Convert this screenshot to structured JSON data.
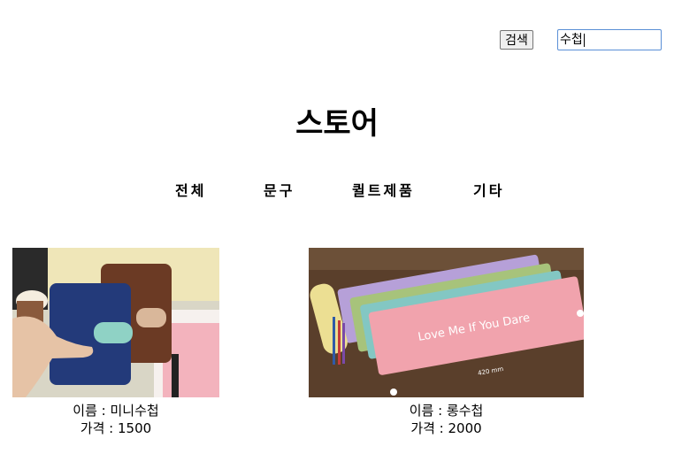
{
  "header": {
    "search_button_label": "검색",
    "search_value": "수첩"
  },
  "store_title": "스토어",
  "nav": {
    "items": [
      {
        "label": "전체"
      },
      {
        "label": "문구"
      },
      {
        "label": "퀼트제품"
      },
      {
        "label": "기타"
      }
    ]
  },
  "products": [
    {
      "name_line": "이름 : 미니수첩",
      "price_line": "가격 : 1500"
    },
    {
      "name_line": "이름 : 롱수첩",
      "price_line": "가격 : 2000",
      "image_text": "Love Me If You Dare",
      "image_measure": "420 mm"
    }
  ]
}
